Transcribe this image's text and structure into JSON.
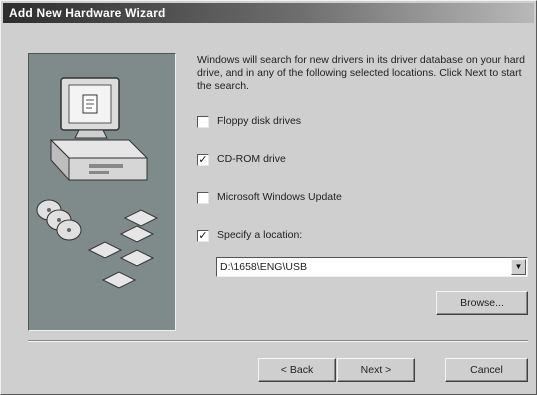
{
  "window": {
    "title": "Add New Hardware Wizard"
  },
  "intro_text": "Windows will search for new drivers in its driver database on your hard drive, and in any of the following selected locations. Click Next to start the search.",
  "options": [
    {
      "label": "Floppy disk drives",
      "checked": false
    },
    {
      "label": "CD-ROM drive",
      "checked": true
    },
    {
      "label": "Microsoft Windows Update",
      "checked": false
    },
    {
      "label": "Specify a location:",
      "checked": true
    }
  ],
  "location": {
    "value": "D:\\1658\\ENG\\USB"
  },
  "buttons": {
    "browse": "Browse...",
    "back": "< Back",
    "next": "Next >",
    "cancel": "Cancel"
  }
}
